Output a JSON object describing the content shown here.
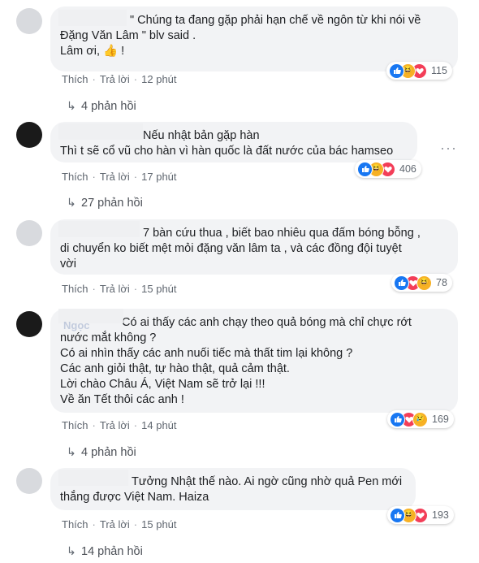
{
  "comments": [
    {
      "lines": [
        "\" Chúng ta đang gặp phải hạn chế về ngôn từ khi nói về",
        "Đặng Văn Lâm \" blv said .",
        "Lâm ơi, 👍 !"
      ],
      "like_label": "Thích",
      "reply_label": "Trả lời",
      "time": "12 phút",
      "reaction_count": "115",
      "reactions": [
        "like-icon",
        "haha-icon",
        "love-icon"
      ],
      "replies_label": "4 phản hồi"
    },
    {
      "lines": [
        "Nếu nhật bản gặp hàn",
        "Thì t sẽ cổ vũ cho hàn vì hàn quốc là đất nước của bác hamseo"
      ],
      "like_label": "Thích",
      "reply_label": "Trả lời",
      "time": "17 phút",
      "reaction_count": "406",
      "reactions": [
        "like-icon",
        "haha-icon",
        "love-icon"
      ],
      "replies_label": "27 phản hồi"
    },
    {
      "lines": [
        "7 bàn cứu thua , biết bao nhiêu qua đấm bóng bỗng ,",
        "di chuyển ko biết mệt mỏi đặng văn lâm ta , và các đồng đội tuyệt",
        "vời"
      ],
      "like_label": "Thích",
      "reply_label": "Trả lời",
      "time": "15 phút",
      "reaction_count": "78",
      "reactions": [
        "like-icon",
        "love-icon",
        "haha-icon"
      ]
    },
    {
      "name_partial": "Ngọc",
      "lines": [
        "Có ai thấy các anh chạy theo quả bóng mà chỉ chực rớt",
        "nước mắt không ?",
        "Có ai nhìn thấy các anh nuối tiếc mà thất tim lại không ?",
        "Các anh giỏi thật, tự hào thật, quả cảm thật.",
        "Lời chào Châu Á, Việt Nam sẽ trở lại !!!",
        "Về ăn Tết thôi các anh !"
      ],
      "like_label": "Thích",
      "reply_label": "Trả lời",
      "time": "14 phút",
      "reaction_count": "169",
      "reactions": [
        "like-icon",
        "love-icon",
        "sad-icon"
      ],
      "replies_label": "4 phản hồi"
    },
    {
      "lines": [
        "Tưởng Nhật thế nào. Ai ngờ cũng nhờ quả Pen mới",
        "thắng được Việt Nam. Haiza"
      ],
      "like_label": "Thích",
      "reply_label": "Trả lời",
      "time": "15 phút",
      "reaction_count": "193",
      "reactions": [
        "like-icon",
        "haha-icon",
        "love-icon"
      ],
      "replies_label": "14 phản hồi"
    }
  ],
  "colors": {
    "bubble": "#f2f3f5",
    "meta": "#606770",
    "like": "#1877f2",
    "love": "#f33e58",
    "haha": "#f7b125"
  }
}
